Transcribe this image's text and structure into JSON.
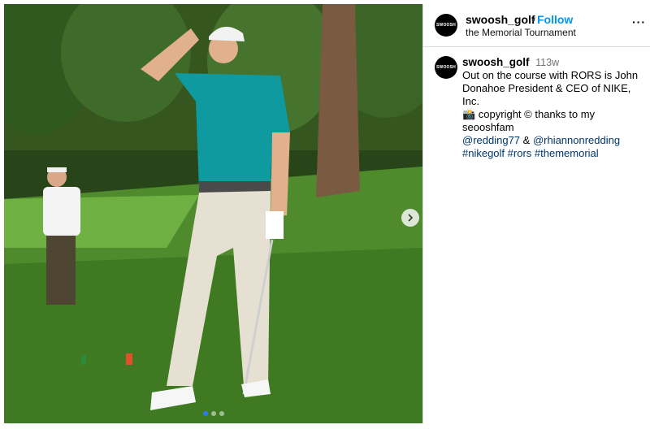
{
  "header": {
    "username": "swoosh_golf",
    "separator": "•",
    "follow_label": "Follow",
    "location": "the Memorial Tournament",
    "more_label": "···",
    "avatar_text": "SWOOSH"
  },
  "post": {
    "username": "swoosh_golf",
    "time": "113w",
    "avatar_text": "SWOOSH",
    "caption_line1": "Out on the course with RORS is John Donahoe President & CEO of NIKE, Inc.",
    "caption_line2": "📸 copyright © thanks to my seooshfam",
    "mention1": "@redding77",
    "amp": " & ",
    "mention2": "@rhiannonredding",
    "hashtag1": "#nikegolf",
    "hashtag2": "#rors",
    "hashtag3": "#thememorial"
  },
  "media": {
    "next_icon": "chevron-right-icon",
    "carousel_count": 3,
    "carousel_active": 1
  },
  "colors": {
    "follow": "#0095f6",
    "link": "#00376b",
    "border": "#dbdbdb",
    "active_dot": "#2b7bf0"
  }
}
